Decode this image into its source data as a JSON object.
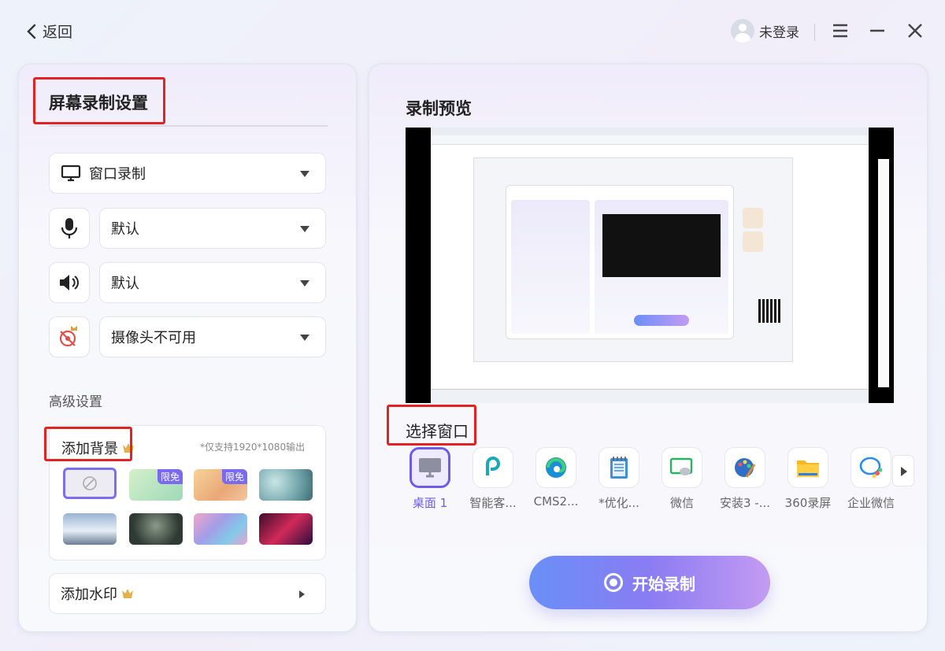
{
  "header": {
    "back_label": "返回",
    "user_label": "未登录"
  },
  "left": {
    "title": "屏幕录制设置",
    "record_mode": "窗口录制",
    "microphone": "默认",
    "speaker": "默认",
    "camera": "摄像头不可用",
    "advanced_label": "高级设置",
    "background": {
      "label": "添加背景",
      "note": "*仅支持1920*1080输出",
      "free_tag": "限免",
      "thumbs": [
        "none",
        "green",
        "sunset",
        "bubbles",
        "mountain",
        "forest",
        "wave",
        "neon"
      ]
    },
    "watermark_label": "添加水印"
  },
  "right": {
    "title": "录制预览",
    "select_window_label": "选择窗口",
    "apps": [
      {
        "label": "桌面 1",
        "icon": "desktop-icon"
      },
      {
        "label": "智能客...",
        "icon": "smart-service-icon"
      },
      {
        "label": "CMS2...",
        "icon": "edge-browser-icon"
      },
      {
        "label": "*优化...",
        "icon": "notepad-icon"
      },
      {
        "label": "微信",
        "icon": "wechat-icon"
      },
      {
        "label": "安装3 -...",
        "icon": "paint-icon"
      },
      {
        "label": "360录屏",
        "icon": "folder-icon"
      },
      {
        "label": "企业微信",
        "icon": "wecom-icon"
      }
    ],
    "start_label": "开始录制"
  },
  "colors": {
    "accent": "#6c5ce7",
    "highlight_box": "#e02424"
  }
}
